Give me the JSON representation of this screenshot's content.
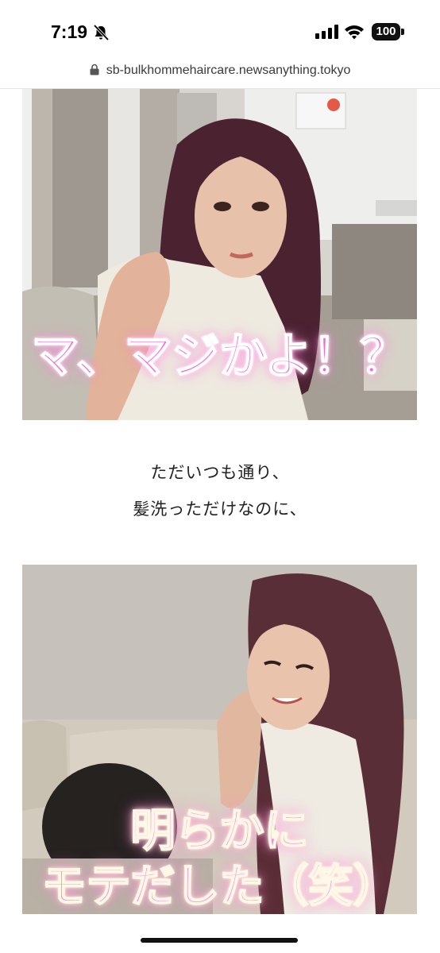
{
  "status_bar": {
    "time": "7:19",
    "battery": "100",
    "icons": [
      "bell-slash-icon",
      "signal-icon",
      "wifi-icon",
      "battery-icon"
    ]
  },
  "browser": {
    "url": "sb-bulkhommehaircare.newsanything.tokyo",
    "icon": "lock-icon"
  },
  "article": {
    "image1_overlay": "マ、マジかよ！？",
    "caption_line1": "ただいつも通り、",
    "caption_line2": "髪洗っただけなのに、",
    "image2_overlay_line1": "明らかに",
    "image2_overlay_line2": "モテだした（笑）"
  },
  "colors": {
    "overlay_pink": "#f06ad0",
    "overlay_outline": "#ffffff",
    "text": "#222222"
  }
}
